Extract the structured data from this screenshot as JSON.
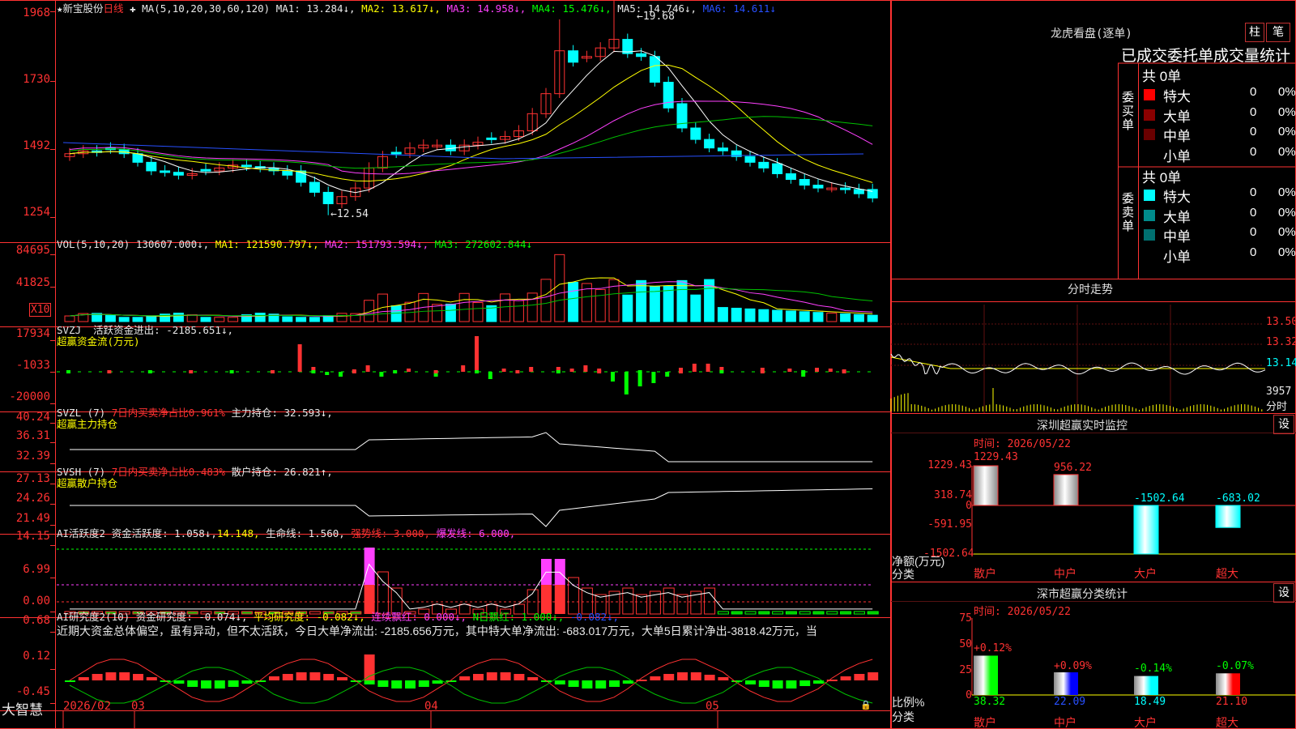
{
  "app": {
    "brand": "大智慧",
    "stock_name": "新宝股份",
    "period": "日线",
    "star": "★"
  },
  "dates": {
    "d1": "2026/02",
    "d2": "03",
    "d3": "04",
    "d4": "05"
  },
  "main": {
    "y_labels": [
      "1968",
      "1730",
      "1492",
      "1254"
    ],
    "ma_params": "MA(5,10,20,30,60,120)",
    "ma1": "MA1: 13.284↓,",
    "ma2": "MA2: 13.617↓,",
    "ma3": "MA3: 14.958↓,",
    "ma4": "MA4: 15.476↓,",
    "ma5": "MA5: 14.746↓,",
    "ma6": "MA6: 14.611↓",
    "high_mark": "19.68",
    "low_mark": "12.54"
  },
  "vol": {
    "y_labels": [
      "84695",
      "41825"
    ],
    "unit": "X10",
    "params": "VOL(5,10,20)",
    "value": "130607.000↓,",
    "ma1": "MA1: 121590.797↓,",
    "ma2": "MA2: 151793.594↓,",
    "ma3": "MA3: 272602.844↓"
  },
  "svzj": {
    "y_labels": [
      "17934",
      "-1033",
      "-20000"
    ],
    "name": "SVZJ",
    "active": "活跃资金进出: -2185.651↓,",
    "sub": "超赢资金流(万元)"
  },
  "svzl": {
    "y_labels": [
      "40.24",
      "36.31",
      "32.39"
    ],
    "name": "SVZL (7)",
    "p1": "7日内买卖净占比0.961%",
    "p2": "主力持仓: 32.593↓,",
    "sub": "超赢主力持仓"
  },
  "svsh": {
    "y_labels": [
      "27.13",
      "24.26",
      "21.49"
    ],
    "name": "SVSH (7)",
    "p1": "7日内买卖净占比0.483%",
    "p2": "散户持仓: 26.821↑,",
    "sub": "超赢散户持仓"
  },
  "ai1": {
    "y_labels": [
      "14.15",
      "6.99",
      "0.00"
    ],
    "name": "AI活跃度2",
    "p1": "资金活跃度: 1.058↓,",
    "p2": "14.148,",
    "p3": "生命线: 1.560,",
    "p4": "强势线: 3.000,",
    "p5": "爆发线: 6.000,"
  },
  "ai2": {
    "y_labels": [
      "0.68",
      "0.12",
      "-0.45"
    ],
    "name": "AI研究度2(10)",
    "p1": "资金研究度: -0.074↓,",
    "p2": "平均研究度: -0.082↓,",
    "p3": "连续飘红: 0.000↓,",
    "p4": "N日飘红: 1.000↓,",
    "p5": "-0.082↓,",
    "comment": "近期大资金总体偏空，虽有异动，但不太活跃，今日大单净流出: -2185.656万元，其中特大单净流出: -683.017万元，大单5日累计净出-3818.42万元，当"
  },
  "panel_lhb": {
    "title": "龙虎看盘(逐单)",
    "btn1": "柱",
    "btn2": "笔",
    "subtitle": "已成交委托单成交量统计",
    "buy": {
      "label": "委买单",
      "total": "共 0单",
      "rows": [
        {
          "name": "特大",
          "v": "0",
          "p": "0%",
          "color": "#ff0000"
        },
        {
          "name": "大单",
          "v": "0",
          "p": "0%",
          "color": "#8b0000"
        },
        {
          "name": "中单",
          "v": "0",
          "p": "0%",
          "color": "#6a0000"
        },
        {
          "name": "小单",
          "v": "0",
          "p": "0%",
          "color": ""
        }
      ]
    },
    "sell": {
      "label": "委卖单",
      "total": "共 0单",
      "rows": [
        {
          "name": "特大",
          "v": "0",
          "p": "0%",
          "color": "#00ffff"
        },
        {
          "name": "大单",
          "v": "0",
          "p": "0%",
          "color": "#008b8b"
        },
        {
          "name": "中单",
          "v": "0",
          "p": "0%",
          "color": "#007070"
        },
        {
          "name": "小单",
          "v": "0",
          "p": "0%",
          "color": ""
        }
      ]
    }
  },
  "panel_fs": {
    "title": "分时走势",
    "prices": [
      "13.50",
      "13.32",
      "13.14"
    ],
    "vol": "3957",
    "unit": "分时"
  },
  "panel_sz": {
    "title": "深圳超赢实时监控",
    "btn": "设",
    "time": "时间: 2026/05/22",
    "y_labels": [
      "1229.43",
      "318.74",
      "0",
      "-591.95",
      "-1502.64"
    ],
    "ylab": "净额(万元)",
    "xlab": "分类",
    "chart_data": {
      "type": "bar",
      "categories": [
        "散户",
        "中户",
        "大户",
        "超大"
      ],
      "values": [
        1229.43,
        956.22,
        -1502.64,
        -683.02
      ],
      "ylim": [
        -1502.64,
        1229.43
      ]
    },
    "vals": [
      "1229.43",
      "956.22",
      "-1502.64",
      "-683.02"
    ]
  },
  "panel_fl": {
    "title": "深市超赢分类统计",
    "btn": "设",
    "time": "时间: 2026/05/22",
    "y_labels": [
      "75",
      "50",
      "25",
      "0"
    ],
    "ylab": "比例%",
    "xlab": "分类",
    "chart_data": {
      "type": "bar",
      "categories": [
        "散户",
        "中户",
        "大户",
        "超大"
      ],
      "values": [
        38.32,
        22.09,
        18.49,
        21.1
      ],
      "changes": [
        "+0.12%",
        "+0.09%",
        "-0.14%",
        "-0.07%"
      ],
      "ylim": [
        0,
        75
      ]
    },
    "vals": [
      "38.32",
      "22.09",
      "18.49",
      "21.10"
    ],
    "changes": [
      "+0.12%",
      "+0.09%",
      "-0.14%",
      "-0.07%"
    ]
  }
}
